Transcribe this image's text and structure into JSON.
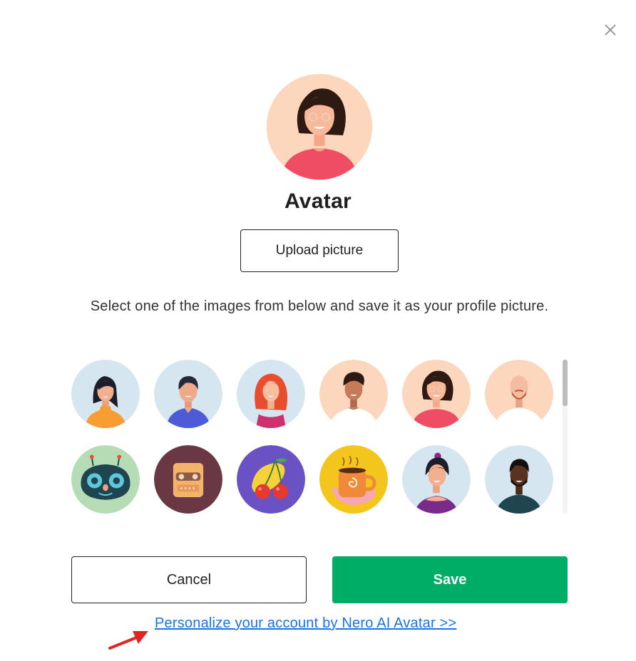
{
  "dialog": {
    "title": "Avatar",
    "upload_label": "Upload picture",
    "description": "Select one of the images from below and save it as your profile picture.",
    "cancel_label": "Cancel",
    "save_label": "Save",
    "link_label": "Personalize your account by Nero AI Avatar >>"
  },
  "colors": {
    "save_bg": "#00ad67",
    "link": "#1a73e8",
    "arrow": "#e02424"
  },
  "icons": {
    "close": "close-icon",
    "arrow": "red-arrow-annotation"
  },
  "avatars": [
    "woman-dark-hair-orange-top",
    "man-blue-shirt",
    "woman-red-curly-hair",
    "man-curly-hair",
    "woman-glasses-pink-top",
    "bald-man-beard",
    "robot-face",
    "retro-robot",
    "cherries",
    "coffee-cup",
    "woman-ponytail",
    "man-dark-skin"
  ]
}
